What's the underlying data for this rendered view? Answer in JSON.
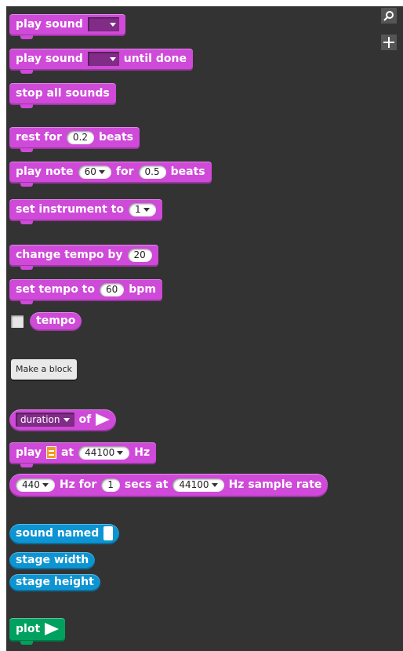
{
  "palette": {
    "category_colors": {
      "sound": "#cf4ad9",
      "sensing": "#0d94d2",
      "pen": "#00a15f"
    },
    "search_icon": "search-icon",
    "add_icon": "plus-icon"
  },
  "blocks": {
    "play_sound": {
      "text": "play sound"
    },
    "play_sound_until": {
      "text1": "play sound",
      "text2": "until done"
    },
    "stop_all": {
      "text": "stop all sounds"
    },
    "rest": {
      "text1": "rest for",
      "value": "0.2",
      "text2": "beats"
    },
    "play_note": {
      "text1": "play note",
      "note": "60",
      "text2": "for",
      "beats": "0.5",
      "text3": "beats"
    },
    "set_instrument": {
      "text": "set instrument to",
      "value": "1"
    },
    "change_tempo": {
      "text": "change tempo by",
      "value": "20"
    },
    "set_tempo": {
      "text1": "set tempo to",
      "value": "60",
      "text2": "bpm"
    },
    "tempo_reporter": {
      "text": "tempo"
    },
    "make_block": {
      "label": "Make a block"
    },
    "duration_of": {
      "dropdown": "duration",
      "text": "of"
    },
    "play_list": {
      "text1": "play",
      "text2": "at",
      "rate": "44100",
      "text3": "Hz"
    },
    "hz_for": {
      "freq": "440",
      "text1": "Hz for",
      "secs": "1",
      "text2": "secs at",
      "rate": "44100",
      "text3": "Hz sample rate"
    },
    "sound_named": {
      "text": "sound named"
    },
    "stage_width": {
      "text": "stage width"
    },
    "stage_height": {
      "text": "stage height"
    },
    "plot": {
      "text": "plot"
    }
  }
}
